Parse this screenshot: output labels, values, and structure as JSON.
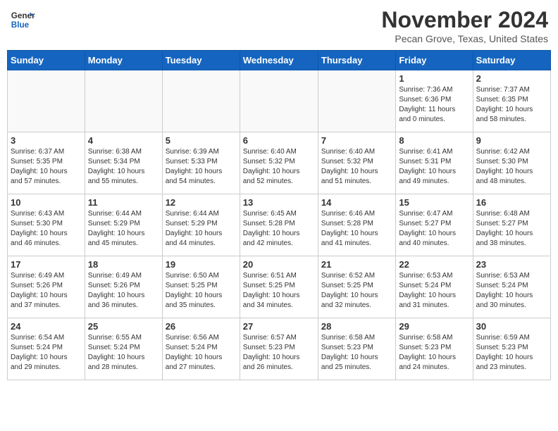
{
  "header": {
    "logo_line1": "General",
    "logo_line2": "Blue",
    "month": "November 2024",
    "location": "Pecan Grove, Texas, United States"
  },
  "weekdays": [
    "Sunday",
    "Monday",
    "Tuesday",
    "Wednesday",
    "Thursday",
    "Friday",
    "Saturday"
  ],
  "weeks": [
    [
      {
        "day": "",
        "info": ""
      },
      {
        "day": "",
        "info": ""
      },
      {
        "day": "",
        "info": ""
      },
      {
        "day": "",
        "info": ""
      },
      {
        "day": "",
        "info": ""
      },
      {
        "day": "1",
        "info": "Sunrise: 7:36 AM\nSunset: 6:36 PM\nDaylight: 11 hours\nand 0 minutes."
      },
      {
        "day": "2",
        "info": "Sunrise: 7:37 AM\nSunset: 6:35 PM\nDaylight: 10 hours\nand 58 minutes."
      }
    ],
    [
      {
        "day": "3",
        "info": "Sunrise: 6:37 AM\nSunset: 5:35 PM\nDaylight: 10 hours\nand 57 minutes."
      },
      {
        "day": "4",
        "info": "Sunrise: 6:38 AM\nSunset: 5:34 PM\nDaylight: 10 hours\nand 55 minutes."
      },
      {
        "day": "5",
        "info": "Sunrise: 6:39 AM\nSunset: 5:33 PM\nDaylight: 10 hours\nand 54 minutes."
      },
      {
        "day": "6",
        "info": "Sunrise: 6:40 AM\nSunset: 5:32 PM\nDaylight: 10 hours\nand 52 minutes."
      },
      {
        "day": "7",
        "info": "Sunrise: 6:40 AM\nSunset: 5:32 PM\nDaylight: 10 hours\nand 51 minutes."
      },
      {
        "day": "8",
        "info": "Sunrise: 6:41 AM\nSunset: 5:31 PM\nDaylight: 10 hours\nand 49 minutes."
      },
      {
        "day": "9",
        "info": "Sunrise: 6:42 AM\nSunset: 5:30 PM\nDaylight: 10 hours\nand 48 minutes."
      }
    ],
    [
      {
        "day": "10",
        "info": "Sunrise: 6:43 AM\nSunset: 5:30 PM\nDaylight: 10 hours\nand 46 minutes."
      },
      {
        "day": "11",
        "info": "Sunrise: 6:44 AM\nSunset: 5:29 PM\nDaylight: 10 hours\nand 45 minutes."
      },
      {
        "day": "12",
        "info": "Sunrise: 6:44 AM\nSunset: 5:29 PM\nDaylight: 10 hours\nand 44 minutes."
      },
      {
        "day": "13",
        "info": "Sunrise: 6:45 AM\nSunset: 5:28 PM\nDaylight: 10 hours\nand 42 minutes."
      },
      {
        "day": "14",
        "info": "Sunrise: 6:46 AM\nSunset: 5:28 PM\nDaylight: 10 hours\nand 41 minutes."
      },
      {
        "day": "15",
        "info": "Sunrise: 6:47 AM\nSunset: 5:27 PM\nDaylight: 10 hours\nand 40 minutes."
      },
      {
        "day": "16",
        "info": "Sunrise: 6:48 AM\nSunset: 5:27 PM\nDaylight: 10 hours\nand 38 minutes."
      }
    ],
    [
      {
        "day": "17",
        "info": "Sunrise: 6:49 AM\nSunset: 5:26 PM\nDaylight: 10 hours\nand 37 minutes."
      },
      {
        "day": "18",
        "info": "Sunrise: 6:49 AM\nSunset: 5:26 PM\nDaylight: 10 hours\nand 36 minutes."
      },
      {
        "day": "19",
        "info": "Sunrise: 6:50 AM\nSunset: 5:25 PM\nDaylight: 10 hours\nand 35 minutes."
      },
      {
        "day": "20",
        "info": "Sunrise: 6:51 AM\nSunset: 5:25 PM\nDaylight: 10 hours\nand 34 minutes."
      },
      {
        "day": "21",
        "info": "Sunrise: 6:52 AM\nSunset: 5:25 PM\nDaylight: 10 hours\nand 32 minutes."
      },
      {
        "day": "22",
        "info": "Sunrise: 6:53 AM\nSunset: 5:24 PM\nDaylight: 10 hours\nand 31 minutes."
      },
      {
        "day": "23",
        "info": "Sunrise: 6:53 AM\nSunset: 5:24 PM\nDaylight: 10 hours\nand 30 minutes."
      }
    ],
    [
      {
        "day": "24",
        "info": "Sunrise: 6:54 AM\nSunset: 5:24 PM\nDaylight: 10 hours\nand 29 minutes."
      },
      {
        "day": "25",
        "info": "Sunrise: 6:55 AM\nSunset: 5:24 PM\nDaylight: 10 hours\nand 28 minutes."
      },
      {
        "day": "26",
        "info": "Sunrise: 6:56 AM\nSunset: 5:24 PM\nDaylight: 10 hours\nand 27 minutes."
      },
      {
        "day": "27",
        "info": "Sunrise: 6:57 AM\nSunset: 5:23 PM\nDaylight: 10 hours\nand 26 minutes."
      },
      {
        "day": "28",
        "info": "Sunrise: 6:58 AM\nSunset: 5:23 PM\nDaylight: 10 hours\nand 25 minutes."
      },
      {
        "day": "29",
        "info": "Sunrise: 6:58 AM\nSunset: 5:23 PM\nDaylight: 10 hours\nand 24 minutes."
      },
      {
        "day": "30",
        "info": "Sunrise: 6:59 AM\nSunset: 5:23 PM\nDaylight: 10 hours\nand 23 minutes."
      }
    ]
  ]
}
